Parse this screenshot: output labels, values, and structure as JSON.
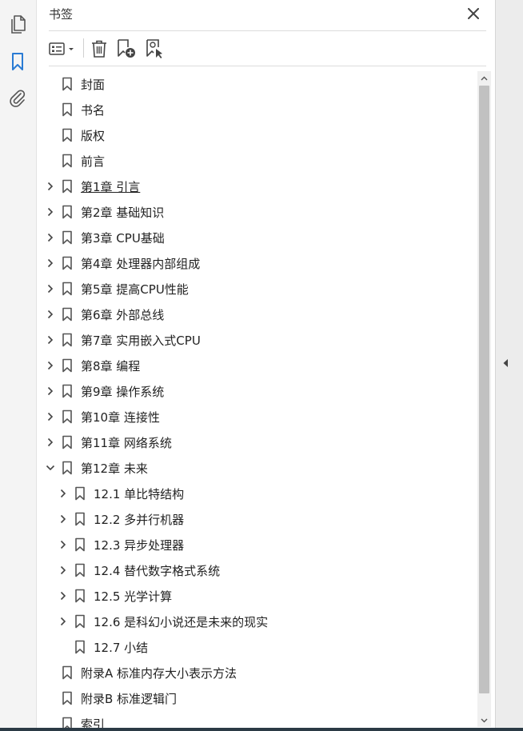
{
  "panel": {
    "title": "书签"
  },
  "icons": {
    "rail": [
      "pages-icon",
      "bookmark-icon",
      "attachment-icon"
    ],
    "accent": "#2a7bd4"
  },
  "bookmarks": [
    {
      "label": "封面",
      "level": 0,
      "expandable": false,
      "expanded": false
    },
    {
      "label": "书名",
      "level": 0,
      "expandable": false,
      "expanded": false
    },
    {
      "label": "版权",
      "level": 0,
      "expandable": false,
      "expanded": false
    },
    {
      "label": "前言",
      "level": 0,
      "expandable": false,
      "expanded": false
    },
    {
      "label": "第1章 引言",
      "level": 0,
      "expandable": true,
      "expanded": false,
      "underlined": true
    },
    {
      "label": "第2章 基础知识",
      "level": 0,
      "expandable": true,
      "expanded": false
    },
    {
      "label": "第3章 CPU基础",
      "level": 0,
      "expandable": true,
      "expanded": false
    },
    {
      "label": "第4章 处理器内部组成",
      "level": 0,
      "expandable": true,
      "expanded": false
    },
    {
      "label": "第5章 提高CPU性能",
      "level": 0,
      "expandable": true,
      "expanded": false
    },
    {
      "label": "第6章 外部总线",
      "level": 0,
      "expandable": true,
      "expanded": false
    },
    {
      "label": "第7章 实用嵌入式CPU",
      "level": 0,
      "expandable": true,
      "expanded": false
    },
    {
      "label": "第8章 编程",
      "level": 0,
      "expandable": true,
      "expanded": false
    },
    {
      "label": "第9章 操作系统",
      "level": 0,
      "expandable": true,
      "expanded": false
    },
    {
      "label": "第10章 连接性",
      "level": 0,
      "expandable": true,
      "expanded": false
    },
    {
      "label": "第11章 网络系统",
      "level": 0,
      "expandable": true,
      "expanded": false
    },
    {
      "label": "第12章 未来",
      "level": 0,
      "expandable": true,
      "expanded": true
    },
    {
      "label": "12.1 单比特结构",
      "level": 1,
      "expandable": true,
      "expanded": false
    },
    {
      "label": "12.2 多并行机器",
      "level": 1,
      "expandable": true,
      "expanded": false
    },
    {
      "label": "12.3 异步处理器",
      "level": 1,
      "expandable": true,
      "expanded": false
    },
    {
      "label": "12.4 替代数字格式系统",
      "level": 1,
      "expandable": true,
      "expanded": false
    },
    {
      "label": "12.5 光学计算",
      "level": 1,
      "expandable": true,
      "expanded": false
    },
    {
      "label": "12.6 是科幻小说还是未来的现实",
      "level": 1,
      "expandable": true,
      "expanded": false
    },
    {
      "label": "12.7 小结",
      "level": 1,
      "expandable": false,
      "expanded": false
    },
    {
      "label": "附录A 标准内存大小表示方法",
      "level": 0,
      "expandable": false,
      "expanded": false
    },
    {
      "label": "附录B 标准逻辑门",
      "level": 0,
      "expandable": false,
      "expanded": false
    },
    {
      "label": "索引",
      "level": 0,
      "expandable": false,
      "expanded": false
    }
  ]
}
